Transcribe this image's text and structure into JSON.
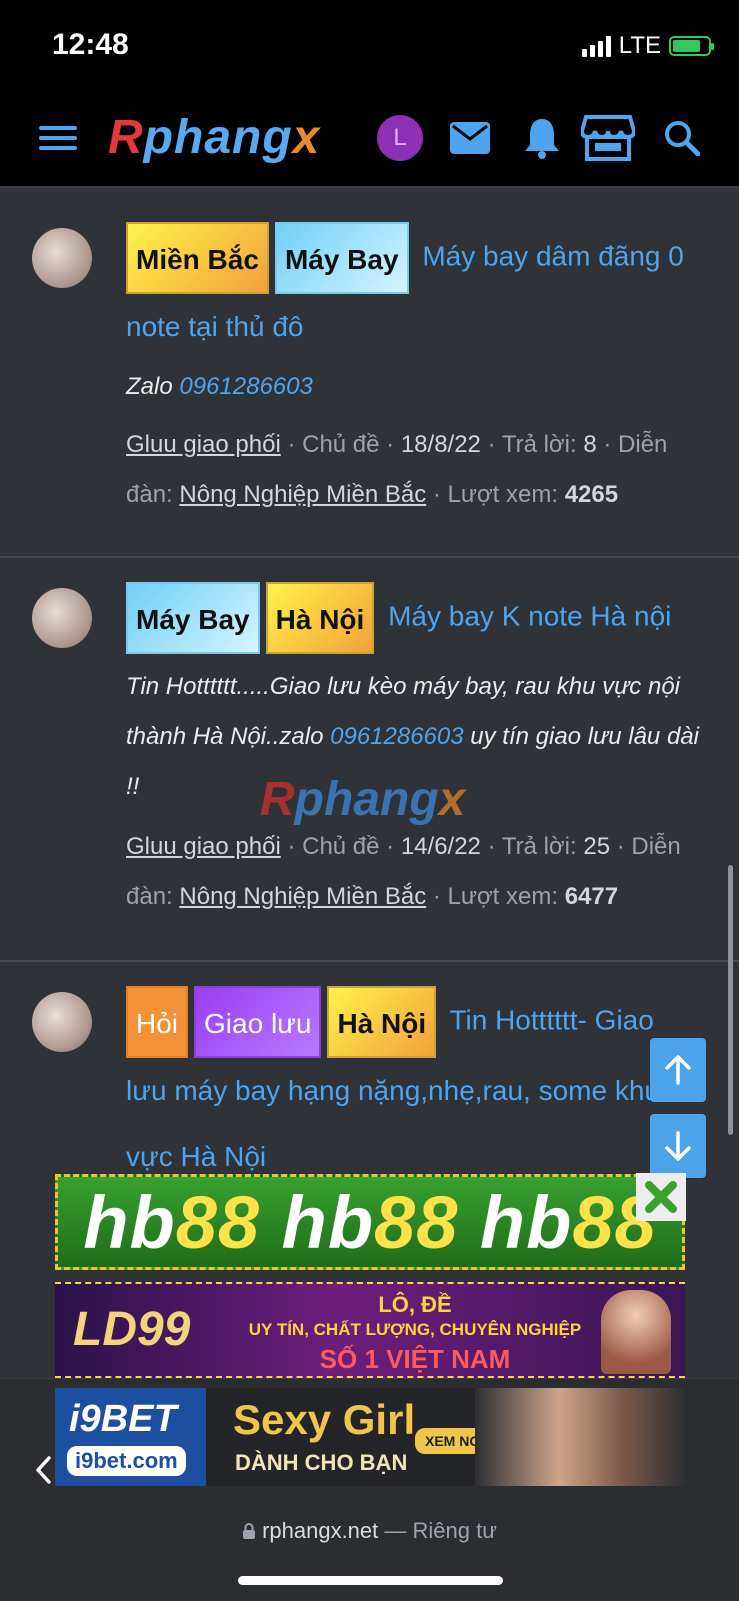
{
  "status": {
    "time": "12:48",
    "network": "LTE",
    "battery_level": 0.8
  },
  "nav": {
    "logo_parts": [
      "R",
      "phang",
      "x"
    ],
    "avatar_letter": "L",
    "icons": [
      "menu-icon",
      "mail-icon",
      "bell-icon",
      "store-icon",
      "search-icon"
    ]
  },
  "threads": [
    {
      "tags": [
        {
          "text": "Miền Bắc",
          "style": "yellow"
        },
        {
          "text": "Máy Bay",
          "style": "blue"
        }
      ],
      "title": "Máy bay dâm đãng 0 note tại thủ đô",
      "snippet_prefix": "Zalo ",
      "snippet_phone": "0961286603",
      "snippet_suffix": "",
      "author": "Gluu giao phối",
      "type": "Chủ đề",
      "date": "18/8/22",
      "replies_label": "Trả lời:",
      "replies": "8",
      "forum_label": "Diễn đàn:",
      "forum": "Nông Nghiệp Miền Bắc",
      "views_label": "Lượt xem:",
      "views": "4265"
    },
    {
      "tags": [
        {
          "text": "Máy Bay",
          "style": "blue"
        },
        {
          "text": "Hà Nội",
          "style": "yellow"
        }
      ],
      "title": "Máy bay K note Hà nội",
      "snippet_prefix": "Tin Hotttttt.....Giao lưu kèo máy bay, rau khu vực nội thành Hà Nội..zalo ",
      "snippet_phone": "0961286603",
      "snippet_suffix": " uy tín giao lưu lâu dài !!",
      "author": "Gluu giao phối",
      "type": "Chủ đề",
      "date": "14/6/22",
      "replies_label": "Trả lời:",
      "replies": "25",
      "forum_label": "Diễn đàn:",
      "forum": "Nông Nghiệp Miền Bắc",
      "views_label": "Lượt xem:",
      "views": "6477"
    },
    {
      "tags": [
        {
          "text": "Hỏi",
          "style": "orange"
        },
        {
          "text": "Giao lưu",
          "style": "purple"
        },
        {
          "text": "Hà Nội",
          "style": "yellow"
        }
      ],
      "title": "Tin Hotttttt- Giao lưu máy bay hạng nặng,nhẹ,rau, some khu vực Hà Nội"
    }
  ],
  "watermark": [
    "R",
    "phang",
    "x"
  ],
  "ads": {
    "hb88": [
      "hb",
      "88",
      " hb",
      "88",
      " hb",
      "88"
    ],
    "ld99": {
      "brand": "LD99",
      "line1": "LÔ, ĐỀ",
      "line2": "UY TÍN, CHẤT LƯỢNG, CHUYÊN NGHIỆP",
      "line3": "SỐ 1 VIỆT NAM"
    },
    "i9bet": {
      "brand": "i9BET",
      "domain": "i9bet.com",
      "headline": "Sexy Girl",
      "sub": "DÀNH CHO BẠN",
      "cta": "XEM NGAY"
    }
  },
  "browser": {
    "domain": "rphangx.net",
    "separator": " — ",
    "mode": "Riêng tư"
  }
}
